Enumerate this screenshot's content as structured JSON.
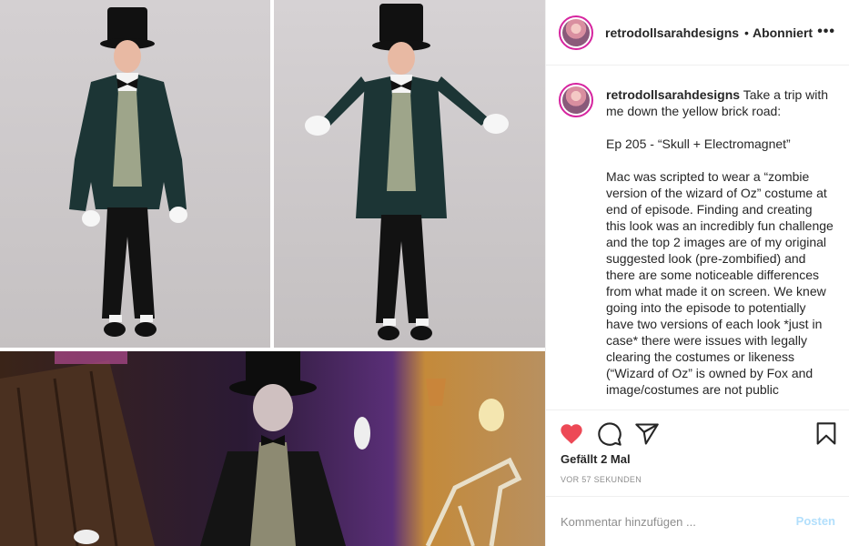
{
  "header": {
    "username": "retrodollsarahdesigns",
    "separator": "•",
    "follow_status": "Abonniert",
    "more_icon": "more-horizontal-icon"
  },
  "caption": {
    "username": "retrodollsarahdesigns",
    "text": "Take a trip with me down the yellow brick road:\n\nEp 205 - “Skull + Electromagnet”\n\nMac was scripted to wear a “zombie version of the wizard of Oz” costume at end of episode. Finding and creating this look was an incredibly fun challenge and the top 2 images are of my original suggested look (pre-zombified) and there are some noticeable differences from what made it on screen. We knew going into the episode to potentially have two versions of each look *just in case* there were issues with legally clearing the costumes or likeness (“Wizard of Oz” is owned by Fox and image/costumes are not public"
  },
  "actions": {
    "like_icon": "heart-filled-icon",
    "comment_icon": "comment-bubble-icon",
    "share_icon": "paper-plane-icon",
    "save_icon": "bookmark-icon",
    "like_color": "#ed4956",
    "likes": "Gefällt 2 Mal",
    "timestamp": "VOR 57 SEKUNDEN"
  },
  "add_comment": {
    "placeholder": "Kommentar hinzufügen ...",
    "post_label": "Posten",
    "post_color": "#b2dffc"
  }
}
